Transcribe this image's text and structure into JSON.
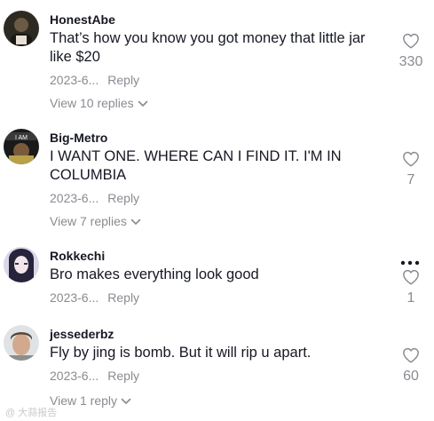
{
  "comments": [
    {
      "username": "HonestAbe",
      "text": "That’s how you know you got money that little jar like $20",
      "date": "2023-6...",
      "reply_label": "Reply",
      "view_replies": "View 10 replies",
      "likes": "330"
    },
    {
      "username": "Big-Metro",
      "text": "I WANT ONE. WHERE CAN I FIND IT. I'M IN COLUMBIA",
      "date": "2023-6...",
      "reply_label": "Reply",
      "view_replies": "View 7 replies",
      "likes": "7"
    },
    {
      "username": "Rokkechi",
      "text": "Bro makes everything look good",
      "date": "2023-6...",
      "reply_label": "Reply",
      "likes": "1"
    },
    {
      "username": "jessederbz",
      "text": "Fly by jing is bomb. But it will rip u apart.",
      "date": "2023-6...",
      "reply_label": "Reply",
      "view_replies": "View 1 reply",
      "likes": "60"
    }
  ],
  "watermark": "@ 大蒜报告",
  "colors": {
    "text": "#161823",
    "muted": "#8a8b91"
  }
}
